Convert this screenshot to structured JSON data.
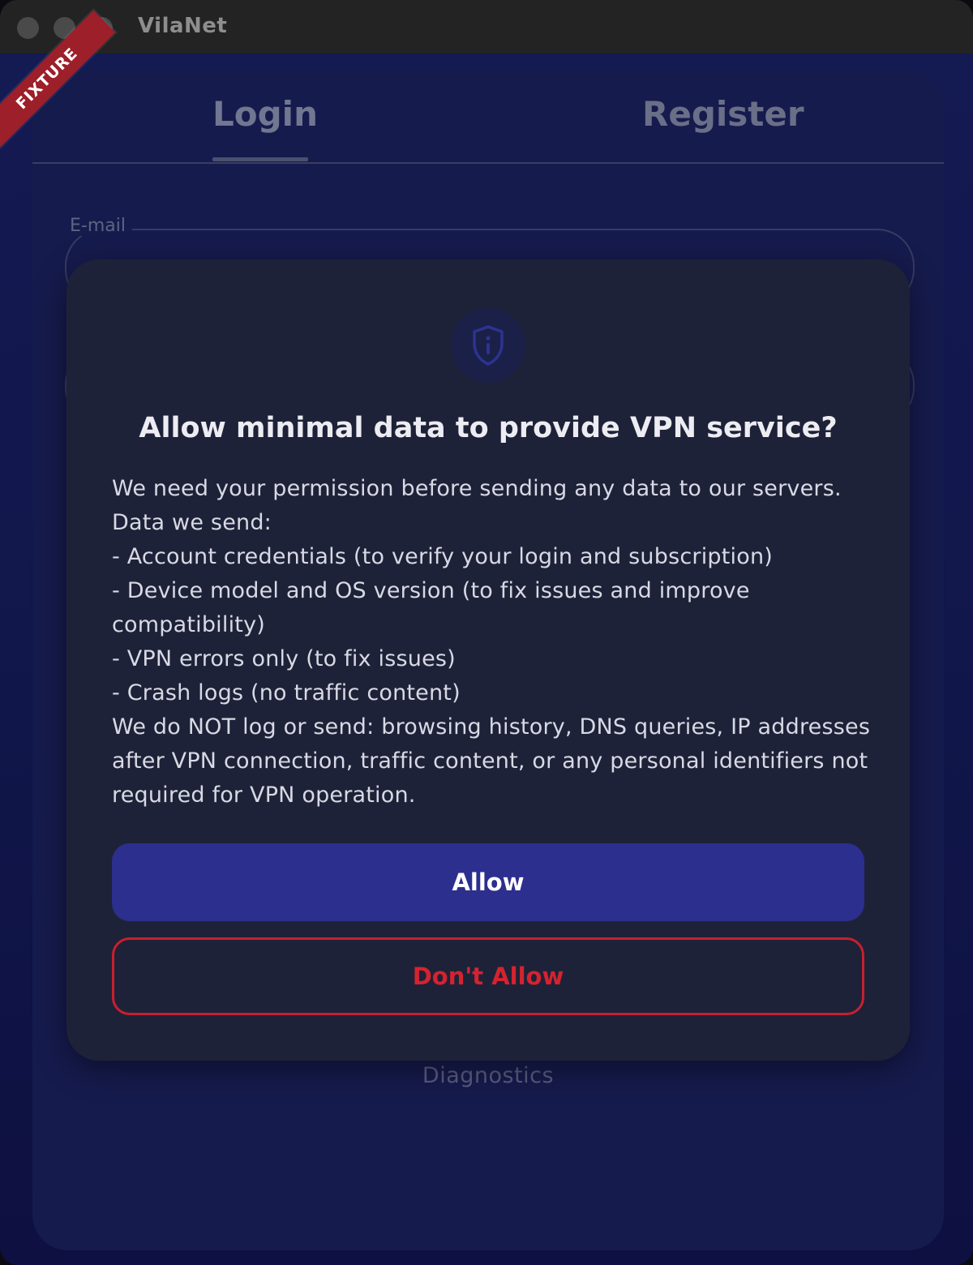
{
  "window": {
    "title": "VilaNet"
  },
  "ribbon": {
    "label": "FIXTURE"
  },
  "tabs": [
    {
      "label": "Login",
      "active": true
    },
    {
      "label": "Register",
      "active": false
    }
  ],
  "form": {
    "email_label": "E-mail"
  },
  "footer": {
    "diagnostics_label": "Diagnostics"
  },
  "dialog": {
    "icon": "shield-info-icon",
    "title": "Allow minimal data to provide VPN service?",
    "body_lines": [
      "We need your permission before sending any data to our servers.",
      "Data we send:",
      "- Account credentials (to verify your login and subscription)",
      "- Device model and OS version (to fix issues and improve compatibility)",
      "- VPN errors only (to fix issues)",
      "- Crash logs (no traffic content)",
      "We do NOT log or send: browsing history, DNS queries, IP addresses after VPN connection, traffic content, or any personal identifiers not required for VPN operation."
    ],
    "allow_label": "Allow",
    "deny_label": "Don't Allow"
  },
  "colors": {
    "accent": "#2c2f8d",
    "danger": "#c7202e",
    "dialog_bg": "#1e2238",
    "app_bg": "#141a52"
  }
}
